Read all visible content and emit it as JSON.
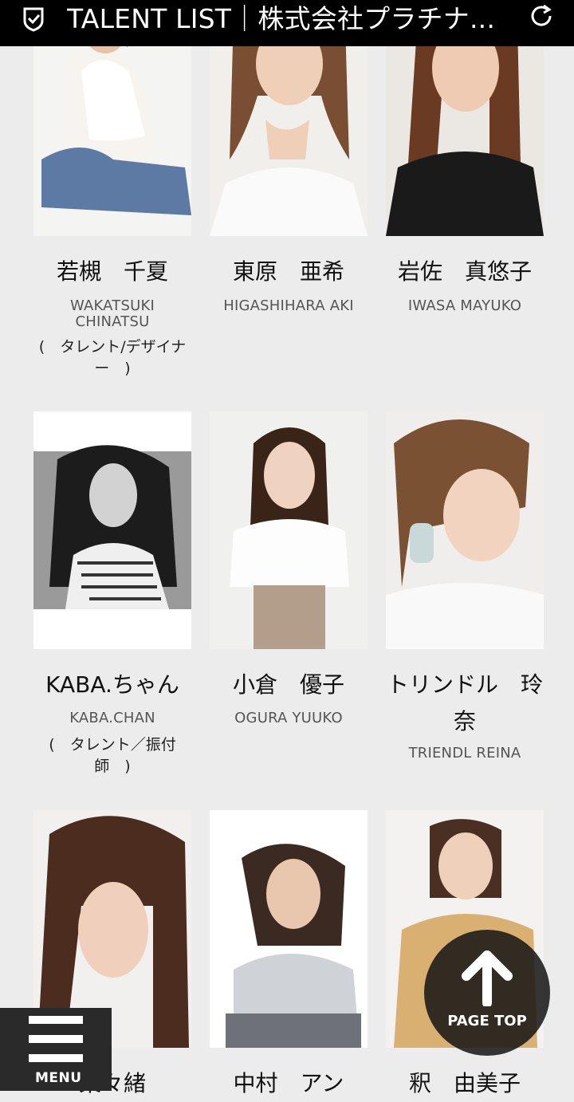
{
  "header": {
    "title": "TALENT LIST｜株式会社プラチナ..."
  },
  "talents": [
    {
      "name": "若槻　千夏",
      "roman": "WAKATSUKI CHINATSU",
      "role": "(　タレント/デザイナー　)"
    },
    {
      "name": "東原　亜希",
      "roman": "HIGASHIHARA AKI",
      "role": ""
    },
    {
      "name": "岩佐　真悠子",
      "roman": "IWASA MAYUKO",
      "role": ""
    },
    {
      "name": "KABA.ちゃん",
      "roman": "KABA.CHAN",
      "role": "(　タレント／振付師　)"
    },
    {
      "name": "小倉　優子",
      "roman": "OGURA YUUKO",
      "role": ""
    },
    {
      "name": "トリンドル　玲奈",
      "roman": "TRIENDL REINA",
      "role": ""
    },
    {
      "name": "菜々緒",
      "roman": "",
      "role": ""
    },
    {
      "name": "中村　アン",
      "roman": "",
      "role": ""
    },
    {
      "name": "釈　由美子",
      "roman": "",
      "role": ""
    }
  ],
  "floating": {
    "menu_label": "MENU",
    "page_top_label": "PAGE TOP"
  }
}
